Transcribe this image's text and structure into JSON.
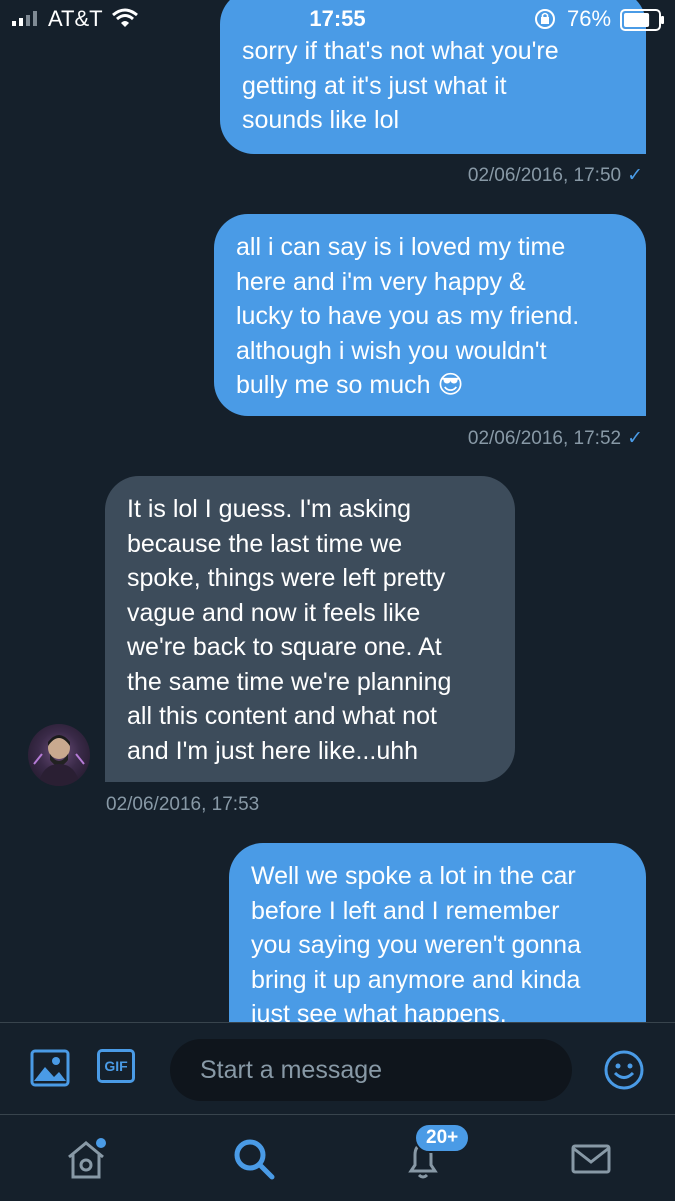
{
  "status_bar": {
    "carrier": "AT&T",
    "time": "17:55",
    "battery": "76%"
  },
  "messages": [
    {
      "direction": "sent",
      "lines": [
        "sorry if that's not what you're",
        "getting at it's just what it",
        "sounds like lol"
      ],
      "timestamp": "02/06/2016, 17:50",
      "read_mark": "✓"
    },
    {
      "direction": "sent",
      "lines": [
        "all i can say is i loved my time",
        "here and i'm very happy &",
        "lucky to have you as my friend.",
        "although i wish you wouldn't",
        "bully me so much 😎"
      ],
      "timestamp": "02/06/2016, 17:52",
      "read_mark": "✓"
    },
    {
      "direction": "received",
      "lines": [
        "It is lol I guess. I'm asking",
        "because the last time we",
        "spoke, things were left pretty",
        "vague and now it feels like",
        "we're back to square one. At",
        "the same time we're planning",
        "all this content and what not",
        "and I'm just here like...uhh"
      ],
      "timestamp": "02/06/2016, 17:53"
    },
    {
      "direction": "sent",
      "lines": [
        "Well we spoke a lot in the car",
        "before I left and I remember",
        "you saying you weren't gonna",
        "bring it up anymore and kinda",
        "just see what happens."
      ]
    }
  ],
  "composer": {
    "gif_label": "GIF",
    "placeholder": "Start a message"
  },
  "tabbar": {
    "notification_badge": "20+"
  },
  "colors": {
    "background": "#15202b",
    "sent_bubble": "#4a9be6",
    "received_bubble": "#3d4c5b",
    "accent": "#4a9be6",
    "muted_text": "#8899a6"
  },
  "icons": [
    "signal-icon",
    "wifi-icon",
    "rotation-lock-icon",
    "battery-icon",
    "image-icon",
    "gif-icon",
    "emoji-icon",
    "home-icon",
    "search-icon",
    "notifications-icon",
    "messages-icon"
  ]
}
